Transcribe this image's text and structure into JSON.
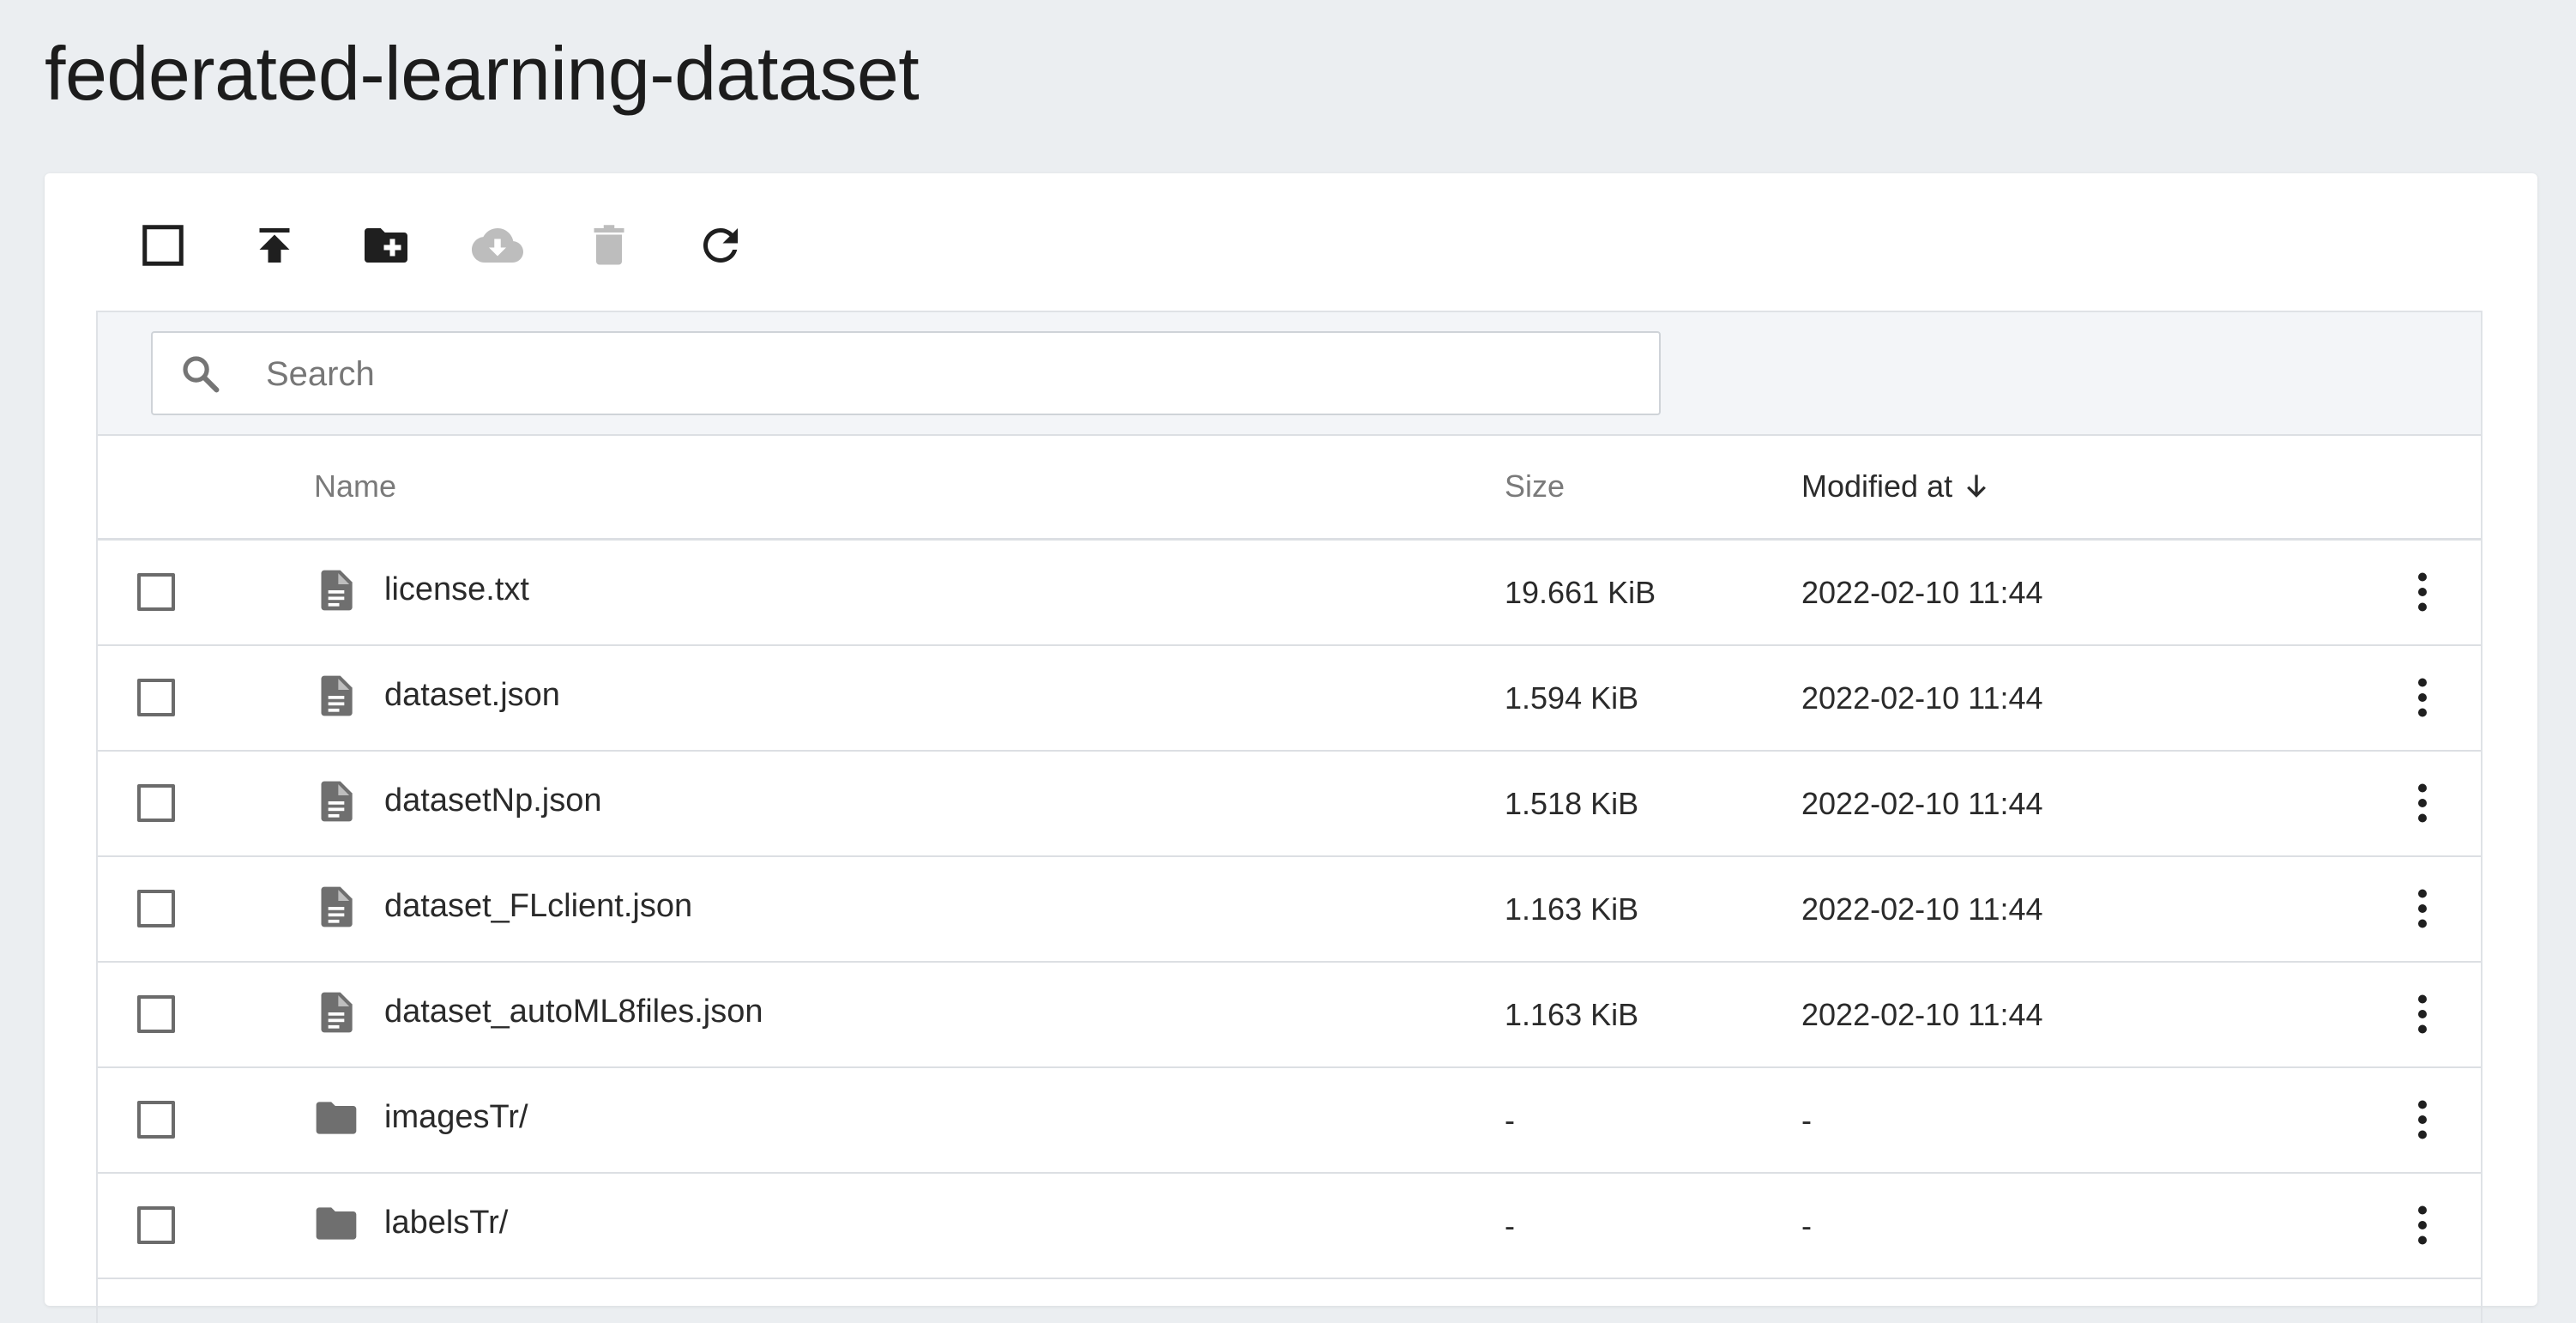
{
  "page": {
    "title": "federated-learning-dataset"
  },
  "toolbar": {
    "buttons": [
      {
        "name": "select-all",
        "icon": "checkbox-outline-icon",
        "enabled": true
      },
      {
        "name": "upload",
        "icon": "upload-icon",
        "enabled": true
      },
      {
        "name": "new-folder",
        "icon": "folder-plus-icon",
        "enabled": true
      },
      {
        "name": "download",
        "icon": "cloud-download-icon",
        "enabled": false
      },
      {
        "name": "delete",
        "icon": "trash-icon",
        "enabled": false
      },
      {
        "name": "refresh",
        "icon": "refresh-icon",
        "enabled": true
      }
    ]
  },
  "search": {
    "placeholder": "Search",
    "value": ""
  },
  "table": {
    "columns": {
      "name": "Name",
      "size": "Size",
      "modified": "Modified at"
    },
    "sort": {
      "column": "modified",
      "direction": "desc"
    },
    "rows": [
      {
        "type": "file",
        "icon": "file-document-icon",
        "name": "license.txt",
        "size": "19.661 KiB",
        "modified": "2022-02-10 11:44"
      },
      {
        "type": "file",
        "icon": "file-document-icon",
        "name": "dataset.json",
        "size": "1.594 KiB",
        "modified": "2022-02-10 11:44"
      },
      {
        "type": "file",
        "icon": "file-document-icon",
        "name": "datasetNp.json",
        "size": "1.518 KiB",
        "modified": "2022-02-10 11:44"
      },
      {
        "type": "file",
        "icon": "file-document-icon",
        "name": "dataset_FLclient.json",
        "size": "1.163 KiB",
        "modified": "2022-02-10 11:44"
      },
      {
        "type": "file",
        "icon": "file-document-icon",
        "name": "dataset_autoML8files.json",
        "size": "1.163 KiB",
        "modified": "2022-02-10 11:44"
      },
      {
        "type": "folder",
        "icon": "folder-icon",
        "name": "imagesTr/",
        "size": "-",
        "modified": "-"
      },
      {
        "type": "folder",
        "icon": "folder-icon",
        "name": "labelsTr/",
        "size": "-",
        "modified": "-"
      }
    ]
  },
  "colors": {
    "background": "#ebeef1",
    "icon_active": "#1f1f1f",
    "icon_disabled": "#bdbdbd",
    "file_icon": "#6f6f6f"
  }
}
